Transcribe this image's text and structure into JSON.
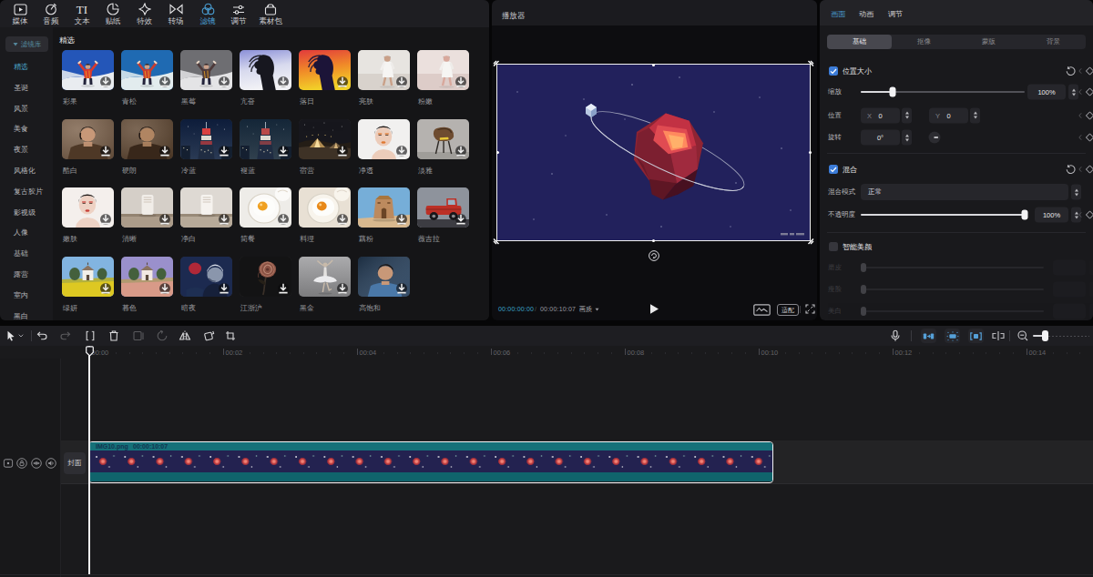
{
  "accent_color": "#4a9fd4",
  "top_toolbar": {
    "items": [
      {
        "label": "媒体",
        "icon": "media-icon",
        "active": false
      },
      {
        "label": "音频",
        "icon": "audio-icon",
        "active": false
      },
      {
        "label": "文本",
        "icon": "text-icon",
        "active": false
      },
      {
        "label": "贴纸",
        "icon": "sticker-icon",
        "active": false
      },
      {
        "label": "特效",
        "icon": "effects-icon",
        "active": false
      },
      {
        "label": "转场",
        "icon": "transition-icon",
        "active": false
      },
      {
        "label": "滤镜",
        "icon": "filter-icon",
        "active": true
      },
      {
        "label": "调节",
        "icon": "adjust-icon",
        "active": false
      },
      {
        "label": "素材包",
        "icon": "package-icon",
        "active": false
      }
    ]
  },
  "filter_panel": {
    "library_label": "滤镜库",
    "categories": [
      {
        "label": "精选",
        "active": true
      },
      {
        "label": "圣诞",
        "active": false
      },
      {
        "label": "风景",
        "active": false
      },
      {
        "label": "美食",
        "active": false
      },
      {
        "label": "夜景",
        "active": false
      },
      {
        "label": "风格化",
        "active": false
      },
      {
        "label": "复古胶片",
        "active": false
      },
      {
        "label": "影视级",
        "active": false
      },
      {
        "label": "人像",
        "active": false
      },
      {
        "label": "基础",
        "active": false
      },
      {
        "label": "露营",
        "active": false
      },
      {
        "label": "室内",
        "active": false
      },
      {
        "label": "黑白",
        "active": false
      }
    ],
    "section_title": "精选",
    "filters": [
      {
        "name": "彩果",
        "scene": "snow",
        "colors": [
          "#2456b8",
          "#e9ecf0",
          "#d8392e"
        ]
      },
      {
        "name": "青松",
        "scene": "snow",
        "colors": [
          "#1f6ab2",
          "#e2ecee",
          "#c83c30"
        ]
      },
      {
        "name": "黑莓",
        "scene": "snow",
        "colors": [
          "#6e6e72",
          "#e4e4e6",
          "#4e3a3a"
        ]
      },
      {
        "name": "亢奋",
        "scene": "hair",
        "colors": [
          "#8a8fd8",
          "#d8daee",
          "#f2f2f6",
          "#17171f"
        ]
      },
      {
        "name": "落日",
        "scene": "hair",
        "colors": [
          "#e23a3c",
          "#f08a28",
          "#f2d028",
          "#1c1438"
        ]
      },
      {
        "name": "亮肤",
        "scene": "walk",
        "colors": [
          "#d8d2cc",
          "#f4f2f0",
          "#c9a088"
        ]
      },
      {
        "name": "粉嫩",
        "scene": "walk",
        "colors": [
          "#ddccc8",
          "#f6f0ee",
          "#d8a89c"
        ]
      },
      {
        "name": "酷白",
        "scene": "manp",
        "colors": [
          "#7a5f48",
          "#4e3826",
          "#c89878"
        ]
      },
      {
        "name": "硬朗",
        "scene": "manp",
        "colors": [
          "#5e452f",
          "#38271a",
          "#b08562"
        ]
      },
      {
        "name": "冷蓝",
        "scene": "city",
        "colors": [
          "#0d1c3a",
          "#2a3a54",
          "#d84040"
        ]
      },
      {
        "name": "褪蓝",
        "scene": "city",
        "colors": [
          "#142638",
          "#30404e",
          "#b84848"
        ]
      },
      {
        "name": "宿营",
        "scene": "camp",
        "colors": [
          "#17171d",
          "#3e3226",
          "#e2b268"
        ]
      },
      {
        "name": "净透",
        "scene": "face",
        "colors": [
          "#f1f0ef",
          "#ecccba",
          "#e07830"
        ]
      },
      {
        "name": "淡雅",
        "scene": "chair",
        "colors": [
          "#b5b2af",
          "#6e4c30",
          "#e8c838"
        ]
      },
      {
        "name": "嫩肤",
        "scene": "face",
        "colors": [
          "#f4efec",
          "#eed2c4",
          "#c84038"
        ]
      },
      {
        "name": "清晰",
        "scene": "speaker",
        "colors": [
          "#d5cfc8",
          "#f1ede8",
          "#a4937f"
        ]
      },
      {
        "name": "净白",
        "scene": "speaker",
        "colors": [
          "#ded9d3",
          "#f6f3ef",
          "#b0a18e"
        ]
      },
      {
        "name": "简餐",
        "scene": "egg",
        "colors": [
          "#eeece8",
          "#fbfaf8",
          "#f0a020"
        ]
      },
      {
        "name": "料理",
        "scene": "egg",
        "colors": [
          "#e8e0d4",
          "#f8f4ec",
          "#e88818"
        ]
      },
      {
        "name": "藕粉",
        "scene": "ruins",
        "colors": [
          "#76aed8",
          "#bc8a5e",
          "#d8b88e"
        ]
      },
      {
        "name": "薇吉拉",
        "scene": "truck",
        "colors": [
          "#8e939c",
          "#bc3026",
          "#3a3a40"
        ]
      },
      {
        "name": "绿妍",
        "scene": "chapel",
        "colors": [
          "#82b4e0",
          "#ddc822",
          "#f2efe8"
        ]
      },
      {
        "name": "暮色",
        "scene": "chapel",
        "colors": [
          "#9a90cc",
          "#d89a88",
          "#f2e9e2"
        ]
      },
      {
        "name": "暗夜",
        "scene": "nightp",
        "colors": [
          "#1c2a50",
          "#b02838",
          "#8a96ac"
        ]
      },
      {
        "name": "江浙沪",
        "scene": "rose",
        "colors": [
          "#131314",
          "#b8897a",
          "#3a3028"
        ]
      },
      {
        "name": "黑金",
        "scene": "dancer",
        "colors": [
          "#9a9a9c",
          "#ebebed",
          "#c8baaa"
        ]
      },
      {
        "name": "高饱和",
        "scene": "blueman",
        "colors": [
          "#27405c",
          "#4a78a8",
          "#c89878"
        ]
      }
    ]
  },
  "player": {
    "title": "播放器",
    "current_time": "00:00:00:00",
    "time_separator": "/",
    "total_time": "00:00:10:07",
    "quality_label": "画质",
    "fit_label": "适配"
  },
  "properties_panel": {
    "tabs": [
      {
        "label": "画面",
        "active": true
      },
      {
        "label": "动画",
        "active": false
      },
      {
        "label": "调节",
        "active": false
      }
    ],
    "sub_tabs": [
      {
        "label": "基础",
        "active": true
      },
      {
        "label": "抠像",
        "active": false
      },
      {
        "label": "蒙版",
        "active": false
      },
      {
        "label": "背景",
        "active": false
      }
    ],
    "position_section": {
      "title": "位置大小",
      "checked": true,
      "scale_label": "缩放",
      "scale_value": "100%",
      "position_label": "位置",
      "x_label": "X",
      "x_value": "0",
      "y_label": "Y",
      "y_value": "0",
      "rotate_label": "旋转",
      "rotate_value": "0°"
    },
    "blend_section": {
      "title": "混合",
      "checked": true,
      "mode_label": "混合模式",
      "mode_value": "正常",
      "opacity_label": "不透明度",
      "opacity_value": "100%"
    },
    "beauty_section": {
      "title": "智能美颜",
      "checked": false,
      "rows": [
        {
          "label": "磨皮"
        },
        {
          "label": "瘦脸"
        },
        {
          "label": "美白"
        }
      ]
    }
  },
  "timeline": {
    "ruler_labels": [
      "00:00",
      "00:02",
      "00:04",
      "00:06",
      "00:08",
      "00:10",
      "00:12",
      "00:14"
    ],
    "cover_label": "封面",
    "clip": {
      "filename": "IMG10.png",
      "duration": "00:00:10:07"
    }
  }
}
